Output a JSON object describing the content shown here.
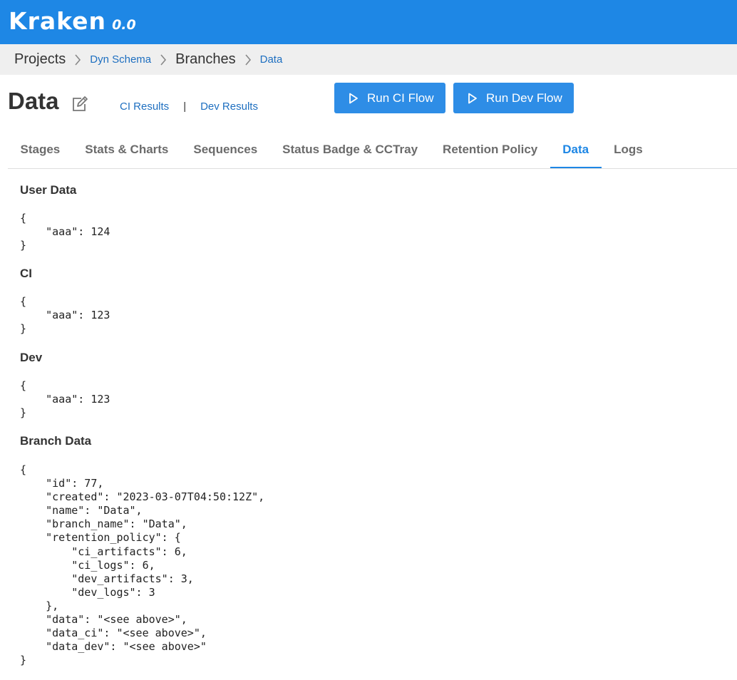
{
  "app": {
    "name": "Kraken",
    "version": "0.0"
  },
  "breadcrumb": {
    "items": [
      "Projects",
      "Dyn Schema",
      "Branches",
      "Data"
    ]
  },
  "page": {
    "title": "Data",
    "ci_results_label": "CI Results",
    "separator": "|",
    "dev_results_label": "Dev Results",
    "run_ci_label": "Run CI Flow",
    "run_dev_label": "Run Dev Flow"
  },
  "tabs": [
    {
      "label": "Stages"
    },
    {
      "label": "Stats & Charts"
    },
    {
      "label": "Sequences"
    },
    {
      "label": "Status Badge & CCTray"
    },
    {
      "label": "Retention Policy"
    },
    {
      "label": "Data",
      "active": true
    },
    {
      "label": "Logs"
    }
  ],
  "sections": {
    "user_data": {
      "title": "User Data",
      "json": "{\n    \"aaa\": 124\n}"
    },
    "ci": {
      "title": "CI",
      "json": "{\n    \"aaa\": 123\n}"
    },
    "dev": {
      "title": "Dev",
      "json": "{\n    \"aaa\": 123\n}"
    },
    "branch_data": {
      "title": "Branch Data",
      "json": "{\n    \"id\": 77,\n    \"created\": \"2023-03-07T04:50:12Z\",\n    \"name\": \"Data\",\n    \"branch_name\": \"Data\",\n    \"retention_policy\": {\n        \"ci_artifacts\": 6,\n        \"ci_logs\": 6,\n        \"dev_artifacts\": 3,\n        \"dev_logs\": 3\n    },\n    \"data\": \"<see above>\",\n    \"data_ci\": \"<see above>\",\n    \"data_dev\": \"<see above>\"\n}"
    }
  },
  "colors": {
    "brand": "#1e87e5",
    "link": "#1e6fc0",
    "button": "#2e8de6"
  }
}
